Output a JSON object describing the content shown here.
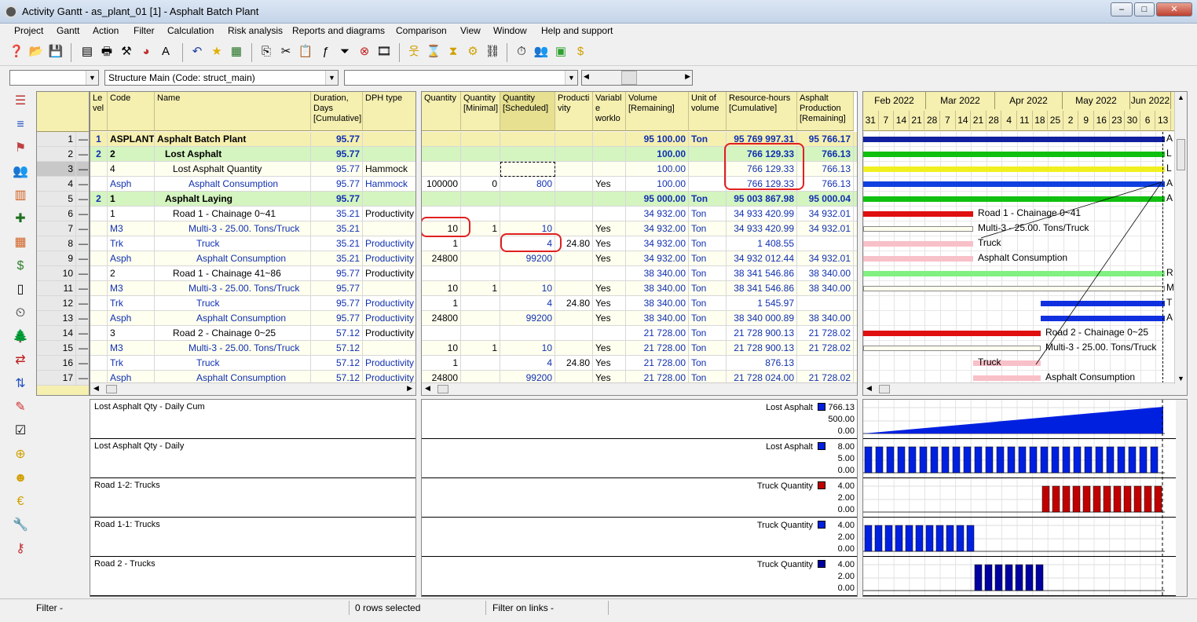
{
  "window": {
    "title": "Activity Gantt - as_plant_01 [1] - Asphalt Batch Plant",
    "min_label": "–",
    "max_label": "□",
    "close_label": "✕"
  },
  "menus": [
    "Project",
    "Gantt",
    "Action",
    "Filter",
    "Calculation",
    "Risk analysis",
    "Reports and diagrams",
    "Comparison",
    "View",
    "Window",
    "Help and support"
  ],
  "combos": {
    "first": "",
    "structure": "Structure Main (Code: struct_main)",
    "third": ""
  },
  "table": {
    "headers": {
      "level": "Le vel",
      "code": "Code",
      "name": "Name",
      "duration": "Duration, Days [Cumulative]",
      "dph": "DPH type"
    },
    "rows": [
      {
        "num": "1",
        "lvl": "1",
        "code": "ASPLANT",
        "name": "Asphalt Batch Plant",
        "dur": "95.77",
        "dph": ""
      },
      {
        "num": "2",
        "lvl": "2",
        "code": "2",
        "name": "Lost Asphalt",
        "dur": "95.77",
        "dph": ""
      },
      {
        "num": "3",
        "lvl": "",
        "code": "4",
        "name": "Lost Asphalt Quantity",
        "dur": "95.77",
        "dph": "Hammock"
      },
      {
        "num": "4",
        "lvl": "",
        "code": "Asph",
        "name": "Asphalt Consumption",
        "dur": "95.77",
        "dph": "Hammock"
      },
      {
        "num": "5",
        "lvl": "2",
        "code": "1",
        "name": "Asphalt Laying",
        "dur": "95.77",
        "dph": ""
      },
      {
        "num": "6",
        "lvl": "",
        "code": "1",
        "name": "Road 1 - Chainage 0~41",
        "dur": "35.21",
        "dph": "Productivity"
      },
      {
        "num": "7",
        "lvl": "",
        "code": "M3",
        "name": "Multi-3 - 25.00. Tons/Truck",
        "dur": "35.21",
        "dph": ""
      },
      {
        "num": "8",
        "lvl": "",
        "code": "Trk",
        "name": "Truck",
        "dur": "35.21",
        "dph": "Productivity"
      },
      {
        "num": "9",
        "lvl": "",
        "code": "Asph",
        "name": "Asphalt Consumption",
        "dur": "35.21",
        "dph": "Productivity"
      },
      {
        "num": "10",
        "lvl": "",
        "code": "2",
        "name": "Road 1 - Chainage 41~86",
        "dur": "95.77",
        "dph": "Productivity"
      },
      {
        "num": "11",
        "lvl": "",
        "code": "M3",
        "name": "Multi-3 - 25.00. Tons/Truck",
        "dur": "95.77",
        "dph": ""
      },
      {
        "num": "12",
        "lvl": "",
        "code": "Trk",
        "name": "Truck",
        "dur": "95.77",
        "dph": "Productivity"
      },
      {
        "num": "13",
        "lvl": "",
        "code": "Asph",
        "name": "Asphalt Consumption",
        "dur": "95.77",
        "dph": "Productivity"
      },
      {
        "num": "14",
        "lvl": "",
        "code": "3",
        "name": "Road 2 - Chainage 0~25",
        "dur": "57.12",
        "dph": "Productivity"
      },
      {
        "num": "15",
        "lvl": "",
        "code": "M3",
        "name": "Multi-3 - 25.00. Tons/Truck",
        "dur": "57.12",
        "dph": ""
      },
      {
        "num": "16",
        "lvl": "",
        "code": "Trk",
        "name": "Truck",
        "dur": "57.12",
        "dph": "Productivity"
      },
      {
        "num": "17",
        "lvl": "",
        "code": "Asph",
        "name": "Asphalt Consumption",
        "dur": "57.12",
        "dph": "Productivity"
      }
    ]
  },
  "table2": {
    "headers": {
      "qty": "Quantity",
      "qmin": "Quantity [Minimal]",
      "qsch": "Quantity [Scheduled]",
      "prod": "Producti vity",
      "var": "Variabl e worklo",
      "vol": "Volume [Remaining]",
      "unit": "Unit of volume",
      "rh": "Resource-hours [Cumulative]",
      "ap": "Asphalt Production [Remaining]"
    },
    "rows": [
      {
        "qty": "",
        "qmin": "",
        "qsch": "",
        "prod": "",
        "var": "",
        "vol": "95 100.00",
        "unit": "Ton",
        "rh": "95 769 997.31",
        "ap": "95 766.17"
      },
      {
        "qty": "",
        "qmin": "",
        "qsch": "",
        "prod": "",
        "var": "",
        "vol": "100.00",
        "unit": "",
        "rh": "766 129.33",
        "ap": "766.13"
      },
      {
        "qty": "",
        "qmin": "",
        "qsch": "",
        "prod": "",
        "var": "",
        "vol": "100.00",
        "unit": "",
        "rh": "766 129.33",
        "ap": "766.13"
      },
      {
        "qty": "100000",
        "qmin": "0",
        "qsch": "800",
        "prod": "",
        "var": "Yes",
        "vol": "100.00",
        "unit": "",
        "rh": "766 129.33",
        "ap": "766.13"
      },
      {
        "qty": "",
        "qmin": "",
        "qsch": "",
        "prod": "",
        "var": "",
        "vol": "95 000.00",
        "unit": "Ton",
        "rh": "95 003 867.98",
        "ap": "95 000.04"
      },
      {
        "qty": "",
        "qmin": "",
        "qsch": "",
        "prod": "",
        "var": "",
        "vol": "34 932.00",
        "unit": "Ton",
        "rh": "34 933 420.99",
        "ap": "34 932.01"
      },
      {
        "qty": "10",
        "qmin": "1",
        "qsch": "10",
        "prod": "",
        "var": "Yes",
        "vol": "34 932.00",
        "unit": "Ton",
        "rh": "34 933 420.99",
        "ap": "34 932.01"
      },
      {
        "qty": "1",
        "qmin": "",
        "qsch": "4",
        "prod": "24.80",
        "var": "Yes",
        "vol": "34 932.00",
        "unit": "Ton",
        "rh": "1 408.55",
        "ap": ""
      },
      {
        "qty": "24800",
        "qmin": "",
        "qsch": "99200",
        "prod": "",
        "var": "Yes",
        "vol": "34 932.00",
        "unit": "Ton",
        "rh": "34 932 012.44",
        "ap": "34 932.01"
      },
      {
        "qty": "",
        "qmin": "",
        "qsch": "",
        "prod": "",
        "var": "",
        "vol": "38 340.00",
        "unit": "Ton",
        "rh": "38 341 546.86",
        "ap": "38 340.00"
      },
      {
        "qty": "10",
        "qmin": "1",
        "qsch": "10",
        "prod": "",
        "var": "Yes",
        "vol": "38 340.00",
        "unit": "Ton",
        "rh": "38 341 546.86",
        "ap": "38 340.00"
      },
      {
        "qty": "1",
        "qmin": "",
        "qsch": "4",
        "prod": "24.80",
        "var": "Yes",
        "vol": "38 340.00",
        "unit": "Ton",
        "rh": "1 545.97",
        "ap": ""
      },
      {
        "qty": "24800",
        "qmin": "",
        "qsch": "99200",
        "prod": "",
        "var": "Yes",
        "vol": "38 340.00",
        "unit": "Ton",
        "rh": "38 340 000.89",
        "ap": "38 340.00"
      },
      {
        "qty": "",
        "qmin": "",
        "qsch": "",
        "prod": "",
        "var": "",
        "vol": "21 728.00",
        "unit": "Ton",
        "rh": "21 728 900.13",
        "ap": "21 728.02"
      },
      {
        "qty": "10",
        "qmin": "1",
        "qsch": "10",
        "prod": "",
        "var": "Yes",
        "vol": "21 728.00",
        "unit": "Ton",
        "rh": "21 728 900.13",
        "ap": "21 728.02"
      },
      {
        "qty": "1",
        "qmin": "",
        "qsch": "4",
        "prod": "24.80",
        "var": "Yes",
        "vol": "21 728.00",
        "unit": "Ton",
        "rh": "876.13",
        "ap": ""
      },
      {
        "qty": "24800",
        "qmin": "",
        "qsch": "99200",
        "prod": "",
        "var": "Yes",
        "vol": "21 728.00",
        "unit": "Ton",
        "rh": "21 728 024.00",
        "ap": "21 728.02"
      }
    ]
  },
  "gantt": {
    "months": [
      "Feb 2022",
      "Mar 2022",
      "Apr 2022",
      "May 2022",
      "Jun 2022"
    ],
    "days": [
      "31",
      "7",
      "14",
      "21",
      "28",
      "7",
      "14",
      "21",
      "28",
      "4",
      "11",
      "18",
      "25",
      "2",
      "9",
      "16",
      "23",
      "30",
      "6",
      "13"
    ],
    "right_labels": [
      "A",
      "L",
      "L",
      "A",
      "A",
      "",
      "",
      "",
      "",
      "R",
      "M",
      "T",
      "A",
      "",
      "",
      "",
      "",
      ""
    ],
    "labels": [
      "Road 1 - Chainage 0~41",
      "Multi-3 - 25.00. Tons/Truck",
      "Truck",
      "Asphalt Consumption",
      "Road 2 - Chainage 0~25",
      "Multi-3 - 25.00. Tons/Truck",
      "Truck",
      "Asphalt Consumption"
    ]
  },
  "charts": [
    {
      "title": "Lost Asphalt Qty - Daily Cum",
      "legend": "Lost Asphalt",
      "color": "#0020e0",
      "ticks": [
        "766.13",
        "500.00",
        "0.00"
      ]
    },
    {
      "title": "Lost Asphalt Qty - Daily",
      "legend": "Lost Asphalt",
      "color": "#0020e0",
      "ticks": [
        "8.00",
        "5.00",
        "0.00"
      ]
    },
    {
      "title": "Road 1-2: Trucks",
      "legend": "Truck Quantity",
      "color": "#c00000",
      "ticks": [
        "4.00",
        "2.00",
        "0.00"
      ]
    },
    {
      "title": "Road 1-1: Trucks",
      "legend": "Truck Quantity",
      "color": "#0020e0",
      "ticks": [
        "4.00",
        "2.00",
        "0.00"
      ]
    },
    {
      "title": "Road 2 - Trucks",
      "legend": "Truck Quantity",
      "color": "#0000a0",
      "ticks": [
        "4.00",
        "2.00",
        "0.00"
      ]
    }
  ],
  "status": {
    "filter": "Filter -",
    "rows_selected": "0 rows selected",
    "filter_links": "Filter on links -"
  }
}
